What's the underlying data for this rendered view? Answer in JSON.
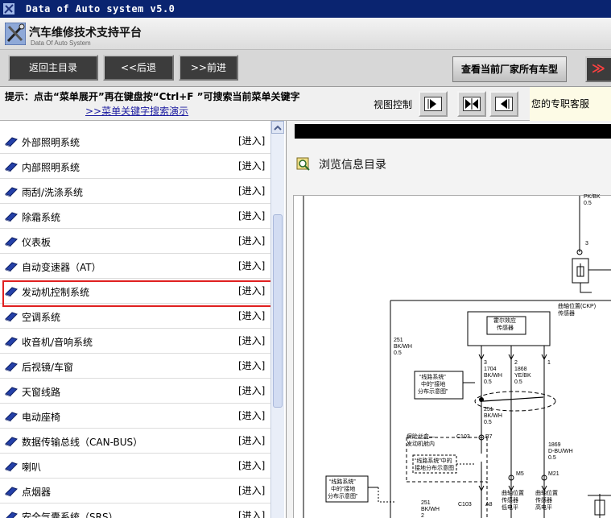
{
  "window": {
    "title": "Data of Auto system v5.0"
  },
  "banner": {
    "title_cn": "汽车维修技术支持平台",
    "title_en": "Data Of Auto System"
  },
  "nav": {
    "home": "返回主目录",
    "back": "<<后退",
    "forward": ">>前进",
    "all_models": "查看当前厂家所有车型",
    "next_glyph": "≫"
  },
  "tips": {
    "text": "提示：点击“菜单展开”再在键盘按“Ctrl+F ”可搜索当前菜单关键字",
    "link": ">>菜单关键字搜索演示",
    "view_label": "视图控制",
    "service": "您的专职客服"
  },
  "menu": {
    "enter_label": "[进入]",
    "items": [
      {
        "label": "外部照明系统"
      },
      {
        "label": "内部照明系统"
      },
      {
        "label": "雨刮/洗涤系统"
      },
      {
        "label": "除霜系统"
      },
      {
        "label": "仪表板"
      },
      {
        "label": "自动变速器（AT）"
      },
      {
        "label": "发动机控制系统",
        "highlighted": true
      },
      {
        "label": "空调系统"
      },
      {
        "label": "收音机/音响系统"
      },
      {
        "label": "后视镜/车窗"
      },
      {
        "label": "天窗线路"
      },
      {
        "label": "电动座椅"
      },
      {
        "label": "数据传输总线（CAN-BUS）"
      },
      {
        "label": "喇叭"
      },
      {
        "label": "点烟器"
      },
      {
        "label": "安全气囊系统（SRS）"
      }
    ]
  },
  "right": {
    "browse_title": "浏览信息目录"
  },
  "diagram": {
    "t1": "PK/BK",
    "t2": "0.5",
    "pin3": "3",
    "ckp1": "曲轴位置(CKP)",
    "ckp2": "传感器",
    "hall1": "霍尔效应",
    "hall2": "传感器",
    "w251a": "251",
    "w251b": "BK/WH",
    "w251c": "0.5",
    "p3": "3",
    "p2": "2",
    "p1": "1",
    "w1704a": "1704",
    "w1704b": "BK/WH",
    "w1704c": "0.5",
    "w1868a": "1868",
    "w1868b": "YE/BK",
    "w1868c": "0.5",
    "box1a": "“线路系统”",
    "box1b": "中的“接地",
    "box1c": "分布示意图”",
    "w251d": "251",
    "w251e": "BK/WH",
    "w251f": "0.5",
    "c103a": "C103",
    "b7": "B7",
    "fuse1": "保险丝盒—",
    "fuse2": "发动机舱内",
    "box2a": "“线路系统”中的",
    "box2b": "接地分布示意图",
    "w1869a": "1869",
    "w1869b": "D-BU/WH",
    "w1869c": "0.5",
    "m5": "M5",
    "m21": "M21",
    "box3a": "“线路系统”",
    "box3b": "中的“接地",
    "box3c": "分布示意图”",
    "w251g": "251",
    "w251h": "BK/WH",
    "w251i": "2",
    "c103b": "C103",
    "a8": "A8",
    "lo1": "曲轴位置",
    "lo2": "传感器",
    "lo3": "低电平",
    "hi1": "曲轴位置",
    "hi2": "传感器",
    "hi3": "高电平"
  }
}
